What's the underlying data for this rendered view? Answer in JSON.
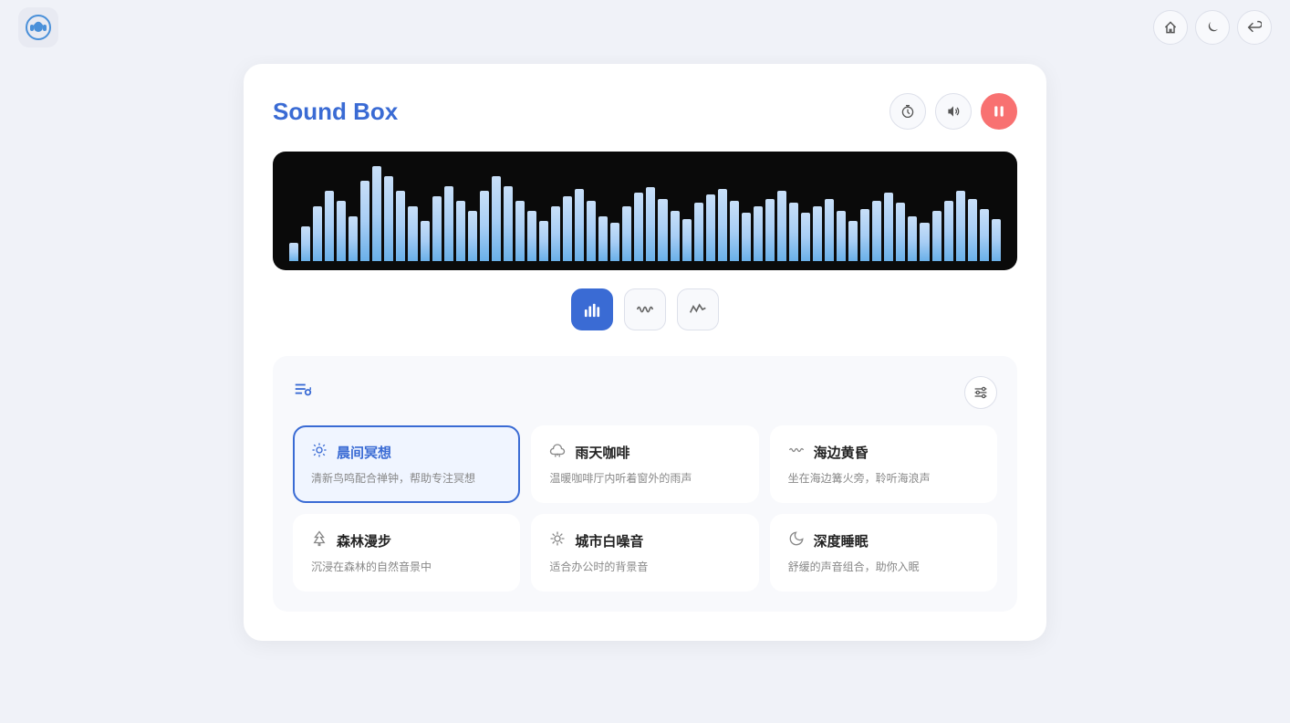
{
  "app": {
    "title": "Sound Box",
    "logo_icon": "🎧"
  },
  "topbar": {
    "home_label": "🏠",
    "moon_label": "🌙",
    "back_label": "↩"
  },
  "header_controls": {
    "timer_icon": "⏱",
    "volume_icon": "🔊",
    "pause_icon": "⏸"
  },
  "viz_controls": [
    {
      "id": "bar",
      "icon": "📊",
      "active": true
    },
    {
      "id": "wave",
      "icon": "〰",
      "active": false
    },
    {
      "id": "line",
      "icon": "∿",
      "active": false
    }
  ],
  "bars": [
    18,
    35,
    55,
    70,
    60,
    45,
    80,
    95,
    85,
    70,
    55,
    40,
    65,
    75,
    60,
    50,
    70,
    85,
    75,
    60,
    50,
    40,
    55,
    65,
    72,
    60,
    45,
    38,
    55,
    68,
    74,
    62,
    50,
    42,
    58,
    66,
    72,
    60,
    48,
    55,
    62,
    70,
    58,
    48,
    55,
    62,
    50,
    40,
    52,
    60,
    68,
    58,
    45,
    38,
    50,
    60,
    70,
    62,
    52,
    42
  ],
  "sounds": [
    {
      "id": "morning",
      "icon": "☀",
      "name": "晨间冥想",
      "desc": "清新鸟鸣配合禅钟，帮助专注冥想",
      "selected": true
    },
    {
      "id": "rainy",
      "icon": "☕",
      "name": "雨天咖啡",
      "desc": "温暖咖啡厅内听着窗外的雨声",
      "selected": false
    },
    {
      "id": "beach",
      "icon": "〰",
      "name": "海边黄昏",
      "desc": "坐在海边篝火旁，聆听海浪声",
      "selected": false
    },
    {
      "id": "forest",
      "icon": "🌿",
      "name": "森林漫步",
      "desc": "沉浸在森林的自然音景中",
      "selected": false
    },
    {
      "id": "city",
      "icon": "🎙",
      "name": "城市白噪音",
      "desc": "适合办公时的背景音",
      "selected": false
    },
    {
      "id": "sleep",
      "icon": "🌙",
      "name": "深度睡眠",
      "desc": "舒缓的声音组合，助你入眠",
      "selected": false
    }
  ]
}
